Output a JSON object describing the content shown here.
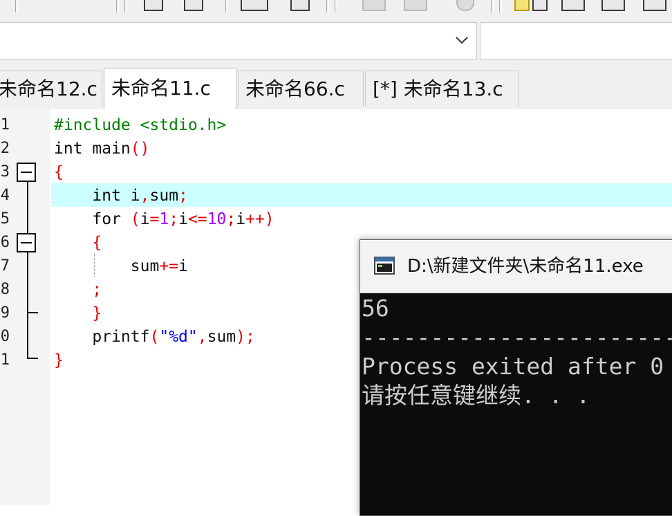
{
  "tabs": [
    {
      "label": "未命名12.c",
      "active": false
    },
    {
      "label": "未命名11.c",
      "active": true
    },
    {
      "label": "未命名66.c",
      "active": false
    },
    {
      "label": "[*] 未命名13.c",
      "active": false
    }
  ],
  "editor": {
    "line_numbers": [
      "1",
      "2",
      "3",
      "4",
      "5",
      "6",
      "7",
      "8",
      "9",
      "0",
      "1"
    ],
    "current_line": 4
  },
  "console": {
    "title": "D:\\新建文件夹\\未命名11.exe",
    "output_value": "56",
    "separator": "--------------------------------",
    "exit_message": "Process exited after 0",
    "prompt": "请按任意键继续. . ."
  },
  "colors": {
    "keyword": "#000000",
    "preprocessor": "#008000",
    "symbol": "#e00000",
    "number": "#9900ff",
    "string": "#0000ff",
    "current_line_bg": "#ccffff",
    "console_bg": "#0c0c0c",
    "console_fg": "#cccccc"
  },
  "icons": [
    "chevron-down-icon",
    "console-app-icon",
    "fold-collapse-icon"
  ]
}
